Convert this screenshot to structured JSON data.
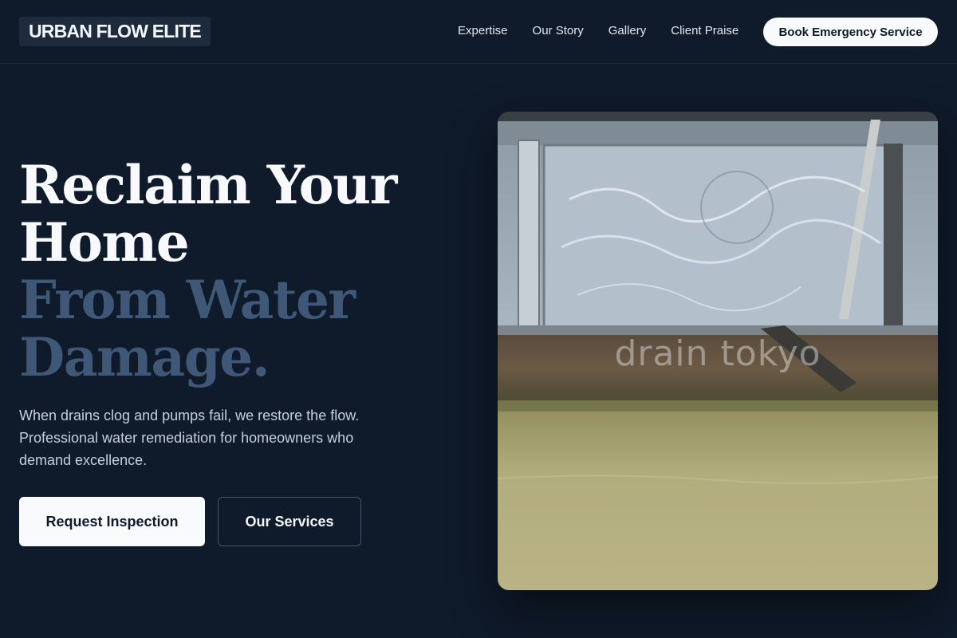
{
  "header": {
    "logo": "URBAN FLOW ELITE",
    "nav": [
      "Expertise",
      "Our Story",
      "Gallery",
      "Client Praise"
    ],
    "cta": "Book Emergency Service"
  },
  "hero": {
    "title_lines": [
      "Reclaim Your",
      "Home"
    ],
    "title_accent_lines": [
      "From Water",
      "Damage."
    ],
    "description": "When drains clog and pumps fail, we restore the flow. Professional water remediation for homeowners who demand excellence.",
    "primary_button": "Request Inspection",
    "secondary_button": "Our Services",
    "image_watermark": "drain tokyo"
  },
  "colors": {
    "background": "#0f1a2a",
    "accent_text": "#3f5878",
    "button_light": "#f8fafc"
  }
}
